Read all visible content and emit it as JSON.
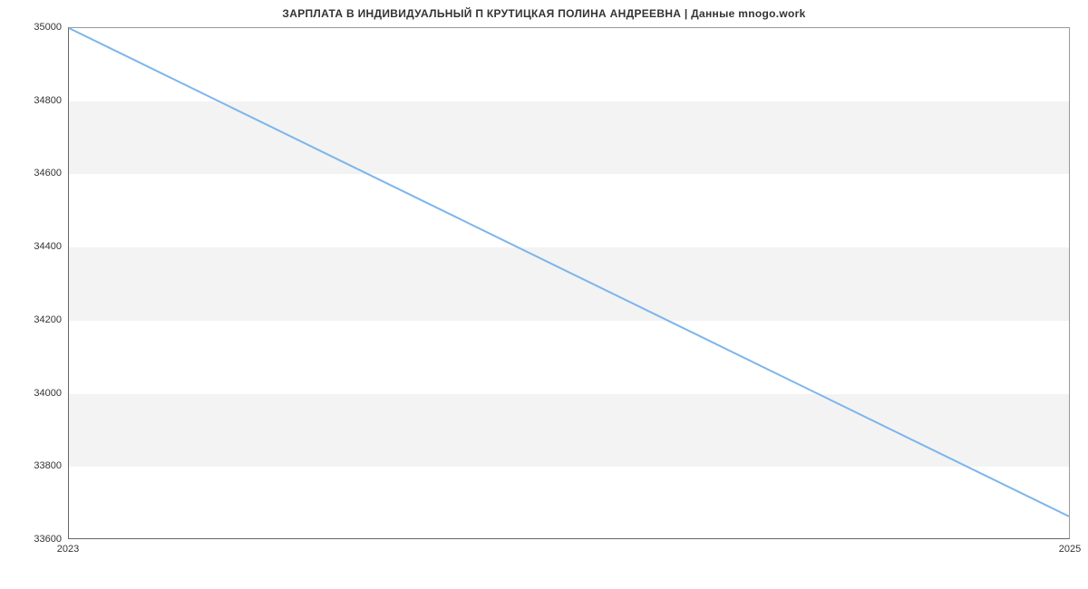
{
  "chart_data": {
    "type": "line",
    "title": "ЗАРПЛАТА В ИНДИВИДУАЛЬНЫЙ П КРУТИЦКАЯ ПОЛИНА АНДРЕЕВНА | Данные mnogo.work",
    "xlabel": "",
    "ylabel": "",
    "x": [
      2023,
      2025
    ],
    "values": [
      35000,
      33660
    ],
    "x_ticks": [
      2023,
      2025
    ],
    "y_ticks": [
      33600,
      33800,
      34000,
      34200,
      34400,
      34600,
      34800,
      35000
    ],
    "ylim": [
      33600,
      35000
    ],
    "xlim": [
      2023,
      2025
    ],
    "bands": [
      [
        33800,
        34000
      ],
      [
        34200,
        34400
      ],
      [
        34600,
        34800
      ]
    ],
    "line_color": "#7cb5ec"
  }
}
